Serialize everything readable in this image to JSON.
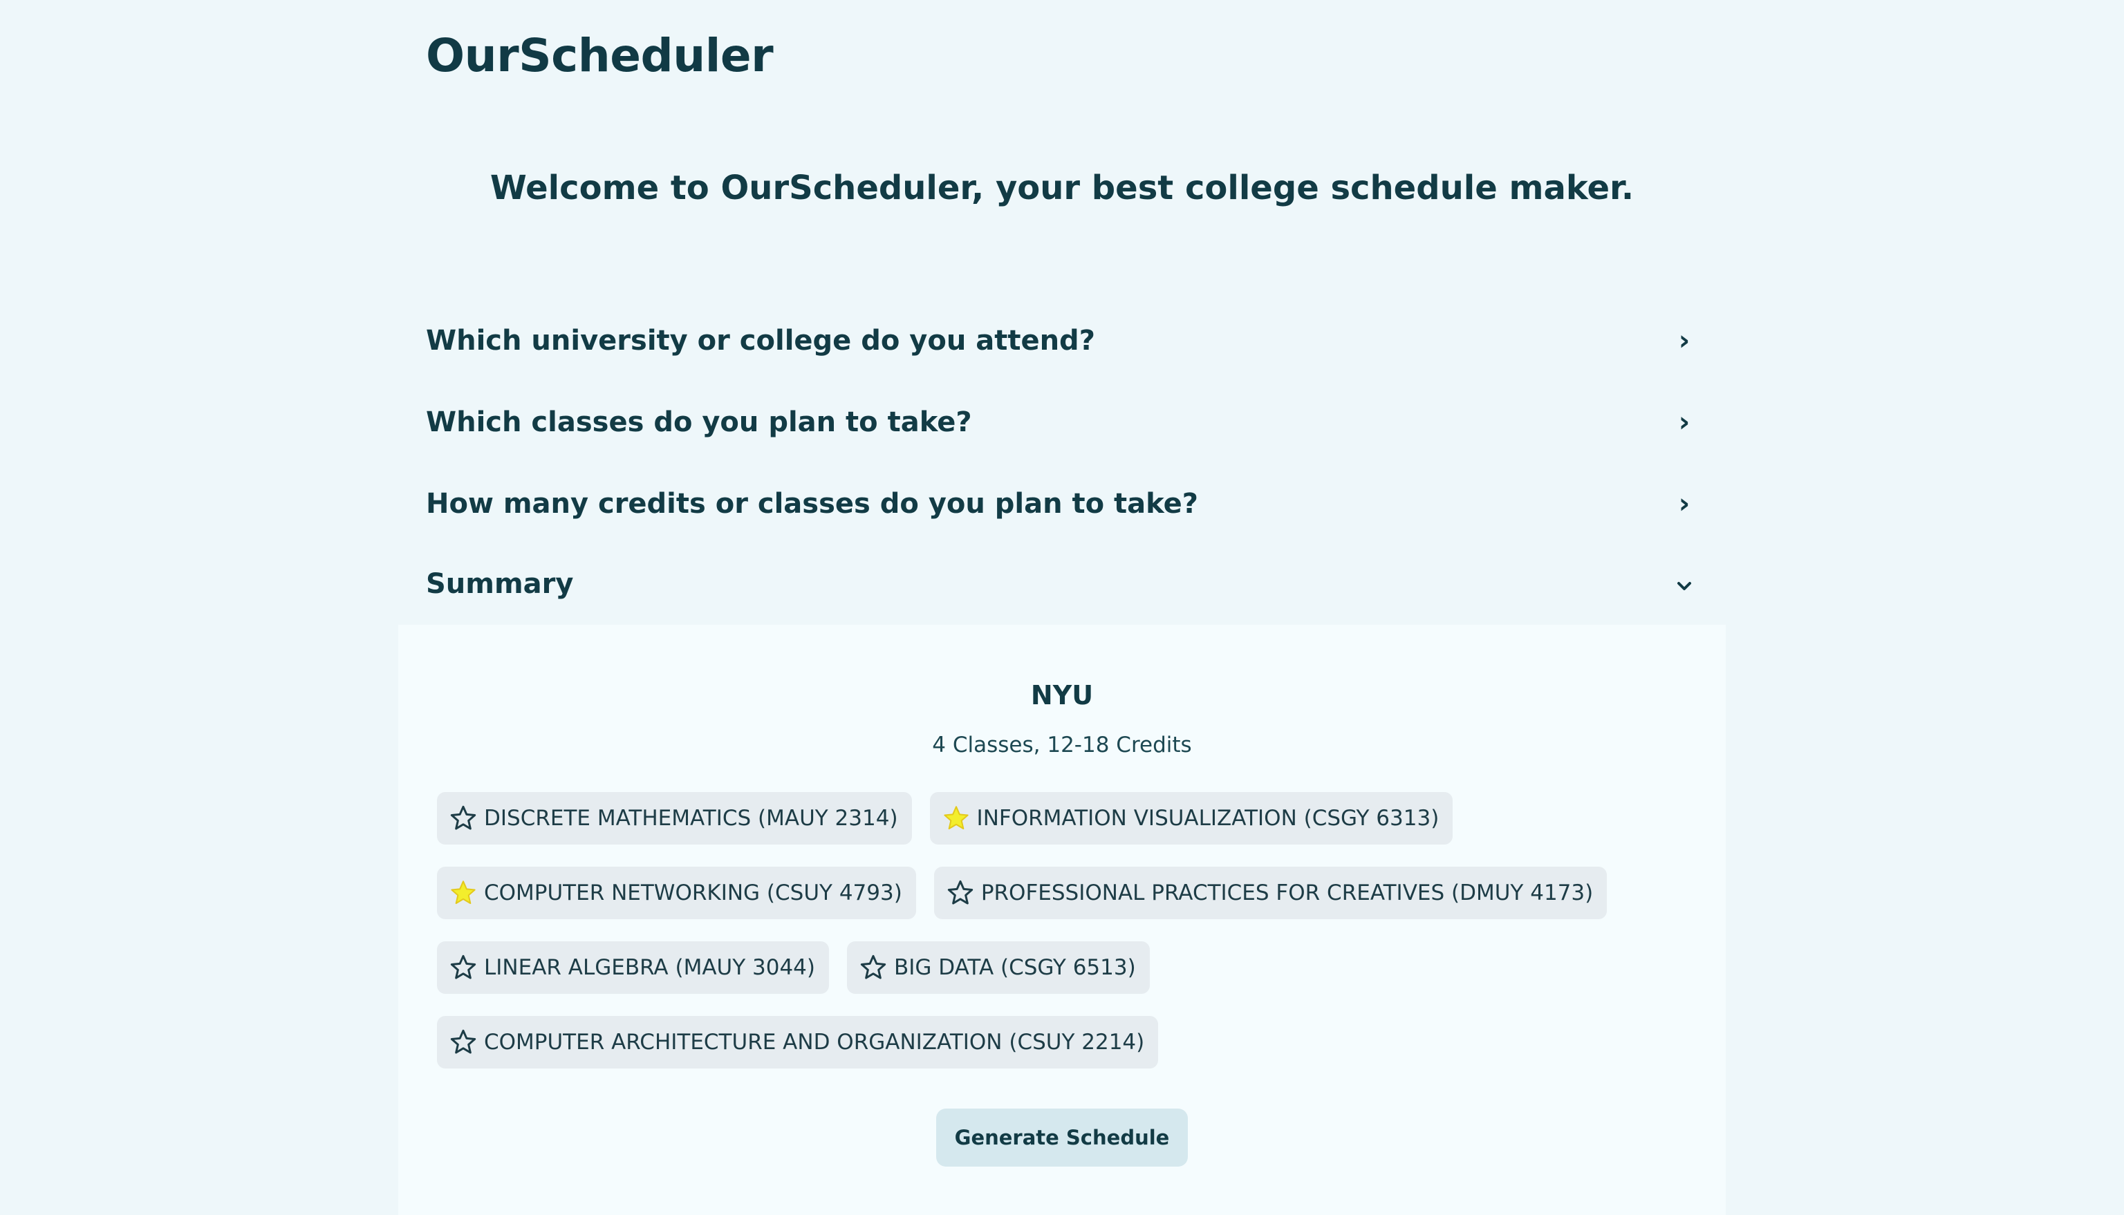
{
  "app": {
    "title": "OurScheduler",
    "welcome": "Welcome to OurScheduler, your best college schedule maker."
  },
  "accordion": [
    {
      "label": "Which university or college do you attend?",
      "state": "collapsed",
      "icon": "chevron-right-icon"
    },
    {
      "label": "Which classes do you plan to take?",
      "state": "collapsed",
      "icon": "chevron-right-icon"
    },
    {
      "label": "How many credits or classes do you plan to take?",
      "state": "collapsed",
      "icon": "chevron-right-icon"
    },
    {
      "label": "Summary",
      "state": "expanded",
      "icon": "chevron-down-icon"
    }
  ],
  "summary": {
    "school": "NYU",
    "credits_text": "4 Classes, 12-18 Credits",
    "classes": [
      {
        "label": "DISCRETE MATHEMATICS (MAUY 2314)",
        "starred": false
      },
      {
        "label": "INFORMATION VISUALIZATION (CSGY 6313)",
        "starred": true
      },
      {
        "label": "COMPUTER NETWORKING (CSUY 4793)",
        "starred": true
      },
      {
        "label": "PROFESSIONAL PRACTICES FOR CREATIVES (DMUY 4173)",
        "starred": false
      },
      {
        "label": "LINEAR ALGEBRA (MAUY 3044)",
        "starred": false
      },
      {
        "label": "BIG DATA (CSGY 6513)",
        "starred": false
      },
      {
        "label": "COMPUTER ARCHITECTURE AND ORGANIZATION (CSUY 2214)",
        "starred": false
      }
    ],
    "generate_label": "Generate Schedule"
  },
  "colors": {
    "page_bg": "#eef7fa",
    "panel_bg": "#f5fcfe",
    "text": "#123b45",
    "chip_bg": "#e6ecf0",
    "star_fill": "#f3ee2c",
    "button_bg": "#d5e8ee"
  }
}
